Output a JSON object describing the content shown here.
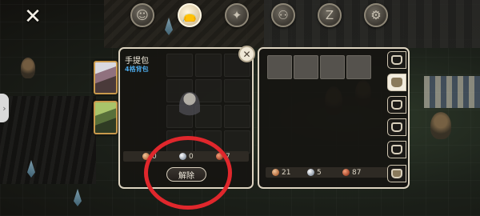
{
  "top_tabs": [
    {
      "id": "character",
      "icon": "character-icon",
      "glyph": "☺"
    },
    {
      "id": "bag",
      "icon": "bag-icon",
      "glyph": "👝"
    },
    {
      "id": "skill",
      "icon": "leaf-icon",
      "glyph": "✦"
    },
    {
      "id": "party",
      "icon": "party-icon",
      "glyph": "⚇"
    },
    {
      "id": "sleep",
      "icon": "sleep-icon",
      "glyph": "Z"
    },
    {
      "id": "settings",
      "icon": "gear-icon",
      "glyph": "⚙"
    }
  ],
  "close_glyph": "✕",
  "bag_panel": {
    "title": "手提包",
    "subtitle": "4格背包",
    "close_glyph": "✕",
    "currency": {
      "bronze": "0",
      "silver": "0",
      "copper": "7"
    },
    "unequip_label": "解除"
  },
  "storage_panel": {
    "currency": {
      "bronze": "21",
      "silver": "5",
      "copper": "87"
    }
  },
  "colors": {
    "panel_border": "#dcd3c0",
    "subtitle_blue": "#4aa4e2",
    "highlight_red": "#e0272c"
  }
}
